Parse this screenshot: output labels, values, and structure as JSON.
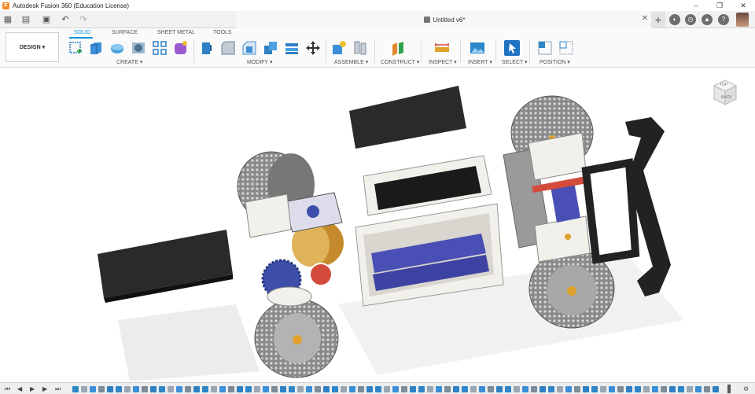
{
  "window": {
    "title": "Autodesk Fusion 360 (Education License)",
    "controls": [
      "–",
      "❐",
      "✕"
    ]
  },
  "tabbar": {
    "quick_access": [
      {
        "name": "app-grid-icon",
        "glyph": "▦"
      },
      {
        "name": "file-menu-icon",
        "glyph": "▤"
      },
      {
        "name": "save-icon",
        "glyph": "▣"
      },
      {
        "name": "undo-icon",
        "glyph": "↶"
      },
      {
        "name": "redo-icon",
        "glyph": "↷"
      }
    ],
    "document_tab": "Untitled v6*",
    "close_glyph": "✕",
    "new_tab_glyph": "+"
  },
  "toolbar": {
    "workspace_button": "DESIGN ▾",
    "workspace_tabs": [
      {
        "label": "SOLID",
        "active": true
      },
      {
        "label": "SURFACE",
        "active": false
      },
      {
        "label": "SHEET METAL",
        "active": false
      },
      {
        "label": "TOOLS",
        "active": false
      }
    ],
    "groups": [
      {
        "label": "CREATE ▾",
        "tools": [
          {
            "name": "create-sketch-icon",
            "color": "#2e7fbf"
          },
          {
            "name": "extrude-icon",
            "color": "#3a8fd8"
          },
          {
            "name": "revolve-icon",
            "color": "#4aa1e0"
          },
          {
            "name": "hole-icon",
            "color": "#6aa8d4"
          },
          {
            "name": "rectangular-pattern-icon",
            "color": "#2f80c4"
          },
          {
            "name": "create-form-icon",
            "color": "#9b59d0"
          }
        ]
      },
      {
        "label": "MODIFY ▾",
        "tools": [
          {
            "name": "press-pull-icon",
            "color": "#2f80c4"
          },
          {
            "name": "fillet-icon",
            "color": "#8aa0b4"
          },
          {
            "name": "chamfer-icon",
            "color": "#3a8fd8"
          },
          {
            "name": "combine-icon",
            "color": "#2e7fbf"
          },
          {
            "name": "shell-icon",
            "color": "#2f80c4"
          },
          {
            "name": "move-copy-icon",
            "color": "#333333"
          }
        ]
      },
      {
        "label": "ASSEMBLE ▾",
        "tools": [
          {
            "name": "new-component-icon",
            "color": "#3a8fd8"
          },
          {
            "name": "joint-icon",
            "color": "#7d8c99"
          }
        ]
      },
      {
        "label": "CONSTRUCT ▾",
        "tools": [
          {
            "name": "offset-plane-icon",
            "color": "#e08a2c"
          }
        ]
      },
      {
        "label": "INSPECT ▾",
        "tools": [
          {
            "name": "measure-icon",
            "color": "#e0a22c"
          }
        ]
      },
      {
        "label": "INSERT ▾",
        "tools": [
          {
            "name": "insert-image-icon",
            "color": "#2e86c9"
          }
        ]
      },
      {
        "label": "SELECT ▾",
        "tools": [
          {
            "name": "select-icon",
            "color": "#1f73c2"
          }
        ]
      },
      {
        "label": "POSITION ▾",
        "tools": [
          {
            "name": "align-icon",
            "color": "#2e86c9"
          },
          {
            "name": "capture-position-icon",
            "color": "#8aa0b4"
          }
        ]
      }
    ]
  },
  "viewcube": {
    "top": "TOP",
    "back": "BACK"
  },
  "timeline": {
    "controls": [
      "⏮",
      "◀",
      "▶",
      "▶",
      "⏭"
    ]
  },
  "colors": {
    "accent": "#0696d7",
    "tire": "#6b6b6b",
    "body": "#f2f0ea",
    "motor": "#c48a2b",
    "battery": "#4a4fb5",
    "gear": "#3d4fa8",
    "red": "#d24b3b",
    "dark": "#2a2a2a"
  }
}
